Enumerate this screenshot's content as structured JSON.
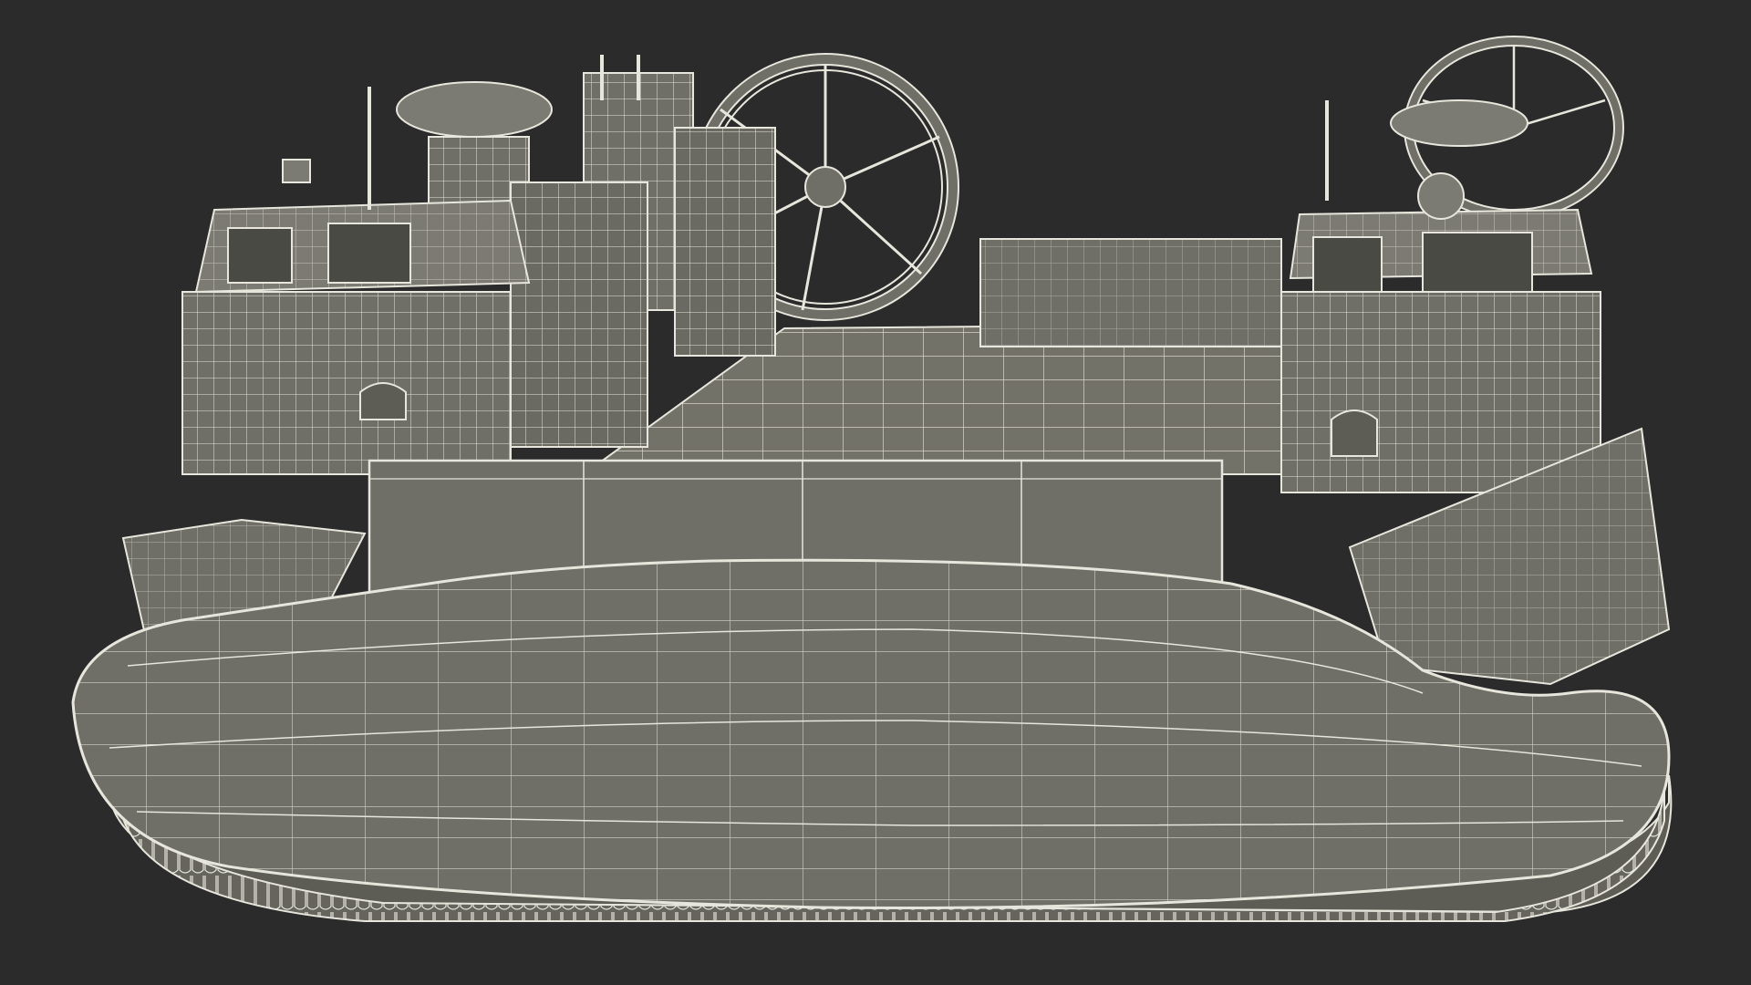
{
  "scene": {
    "subject": "hovercraft-wireframe-render",
    "colors": {
      "background": "#2b2b2b",
      "surface": "#6f6e67",
      "surface_light": "#7c7b73",
      "surface_dark": "#5d5c55",
      "deck": "#737269",
      "wire": "#e7e6dc",
      "glass": "#4a4a45"
    }
  }
}
